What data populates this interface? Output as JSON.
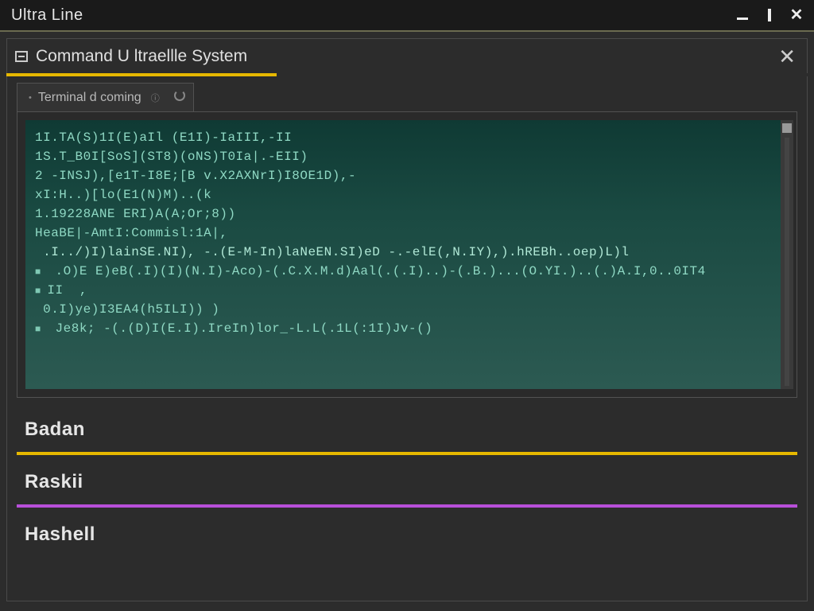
{
  "window": {
    "title": "Ultra Line"
  },
  "panel": {
    "title": "Command U ltraellle System"
  },
  "tab": {
    "label": "Terminal d coming"
  },
  "terminal": {
    "lines": [
      "1I.TA(S)1I(E)aIl (E1I)-IaIII,-II",
      "1S.T_B0I[SoS](ST8)(oNS)T0Ia|.-EII)",
      "2 -INSJ),[e1T-I8E;[B v.X2AXNrI)I8OE1D),-",
      "xI:H..)[lo(E1(N)M)..(k",
      "1.19228ANE ERI)A(A;Or;8))",
      "",
      "HeaBE|-AmtI:Commisl:1A|,",
      " .I../)I)lainSE.NI), -.(E-M-In)laNeEN.SI)eD -.-elE(,N.IY),).hREBh..oep)L)l",
      " .O)E E)eB(.I)(I)(N.I)-Aco)-(.C.X.M.d)Aal(.(.I)..)-(.B.)...(O.YI.)..(.)A.I,0..0IT4",
      "II  ,",
      "",
      " 0.I)ye)I3EA4(h5ILI)) )",
      " Je8k; -(.(D)I(E.I).IreIn)lor_-L.L(.1L(:1I)Jv-()"
    ],
    "head_index": 7,
    "bullet_indices": [
      8,
      9,
      12,
      13
    ]
  },
  "list": {
    "items": [
      {
        "label": "Badan",
        "accent": "accent-yellow"
      },
      {
        "label": "Raskii",
        "accent": "accent-purple"
      },
      {
        "label": "Hashell",
        "accent": "accent-none"
      }
    ]
  }
}
